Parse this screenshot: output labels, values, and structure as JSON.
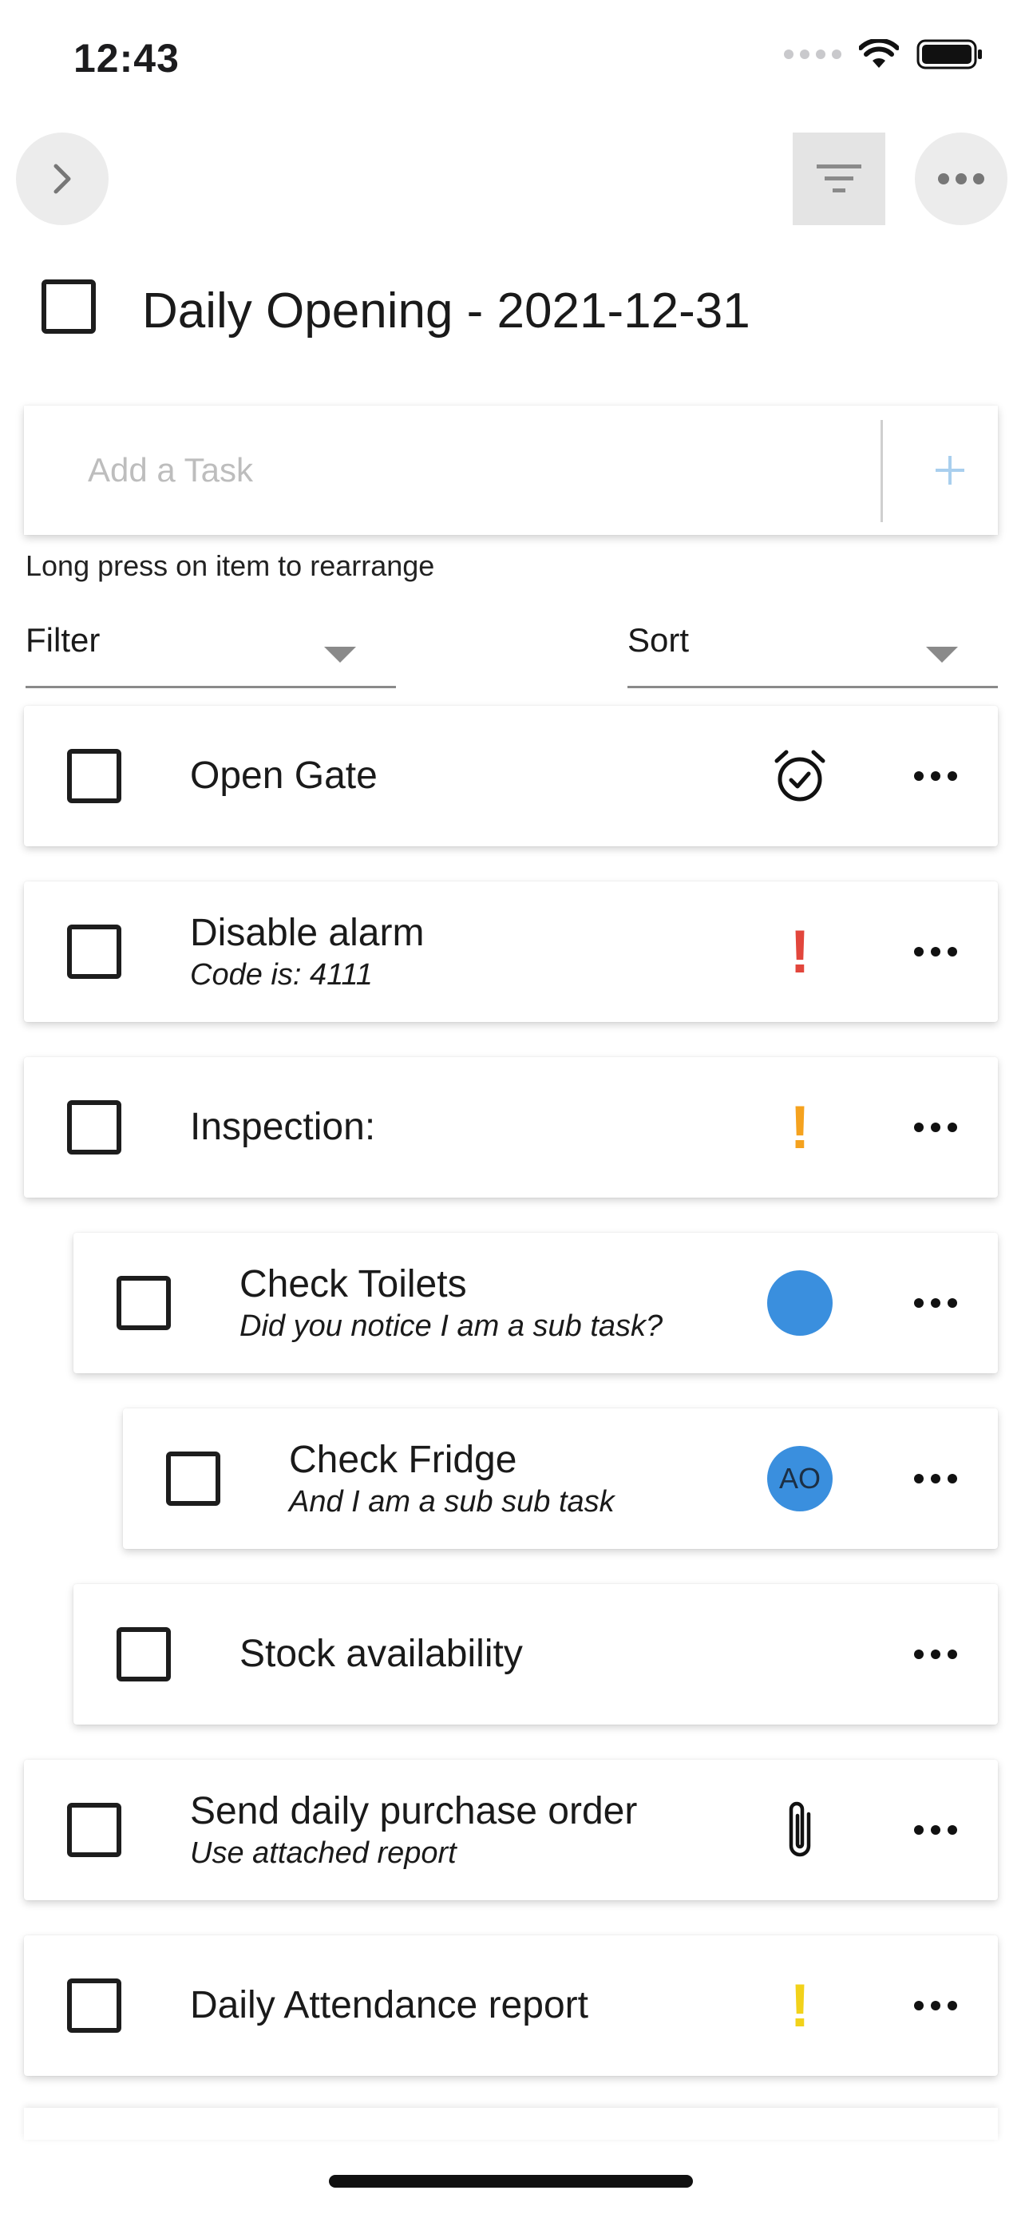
{
  "status_bar": {
    "time": "12:43"
  },
  "header": {
    "list_title": "Daily Opening - 2021-12-31"
  },
  "add_task": {
    "placeholder": "Add a Task",
    "add_symbol": "+"
  },
  "hint": "Long press on item to rearrange",
  "filter": {
    "label": "Filter"
  },
  "sort": {
    "label": "Sort"
  },
  "tasks": [
    {
      "title": "Open Gate",
      "subtitle": "",
      "badge": "alarm-clock-icon",
      "indent_level": 0
    },
    {
      "title": "Disable alarm",
      "subtitle": "Code is: 4111",
      "badge": "!",
      "badge_color": "#e2463c",
      "indent_level": 0
    },
    {
      "title": "Inspection:",
      "subtitle": "",
      "badge": "!",
      "badge_color": "#f5a21e",
      "indent_level": 0
    },
    {
      "title": "Check Toilets",
      "subtitle": "Did you notice I am a sub task?",
      "badge": "avatar",
      "badge_color": "#3a8fde",
      "indent_level": 1
    },
    {
      "title": "Check Fridge",
      "subtitle": "And I am a sub sub task",
      "badge": "avatar",
      "avatar_initials": "AO",
      "badge_color": "#3a8fde",
      "indent_level": 2
    },
    {
      "title": "Stock availability",
      "subtitle": "",
      "badge": "",
      "indent_level": 1
    },
    {
      "title": "Send daily purchase order",
      "subtitle": "Use attached report",
      "badge": "paperclip-icon",
      "indent_level": 0
    },
    {
      "title": "Daily Attendance report",
      "subtitle": "",
      "badge": "!",
      "badge_color": "#f2d21a",
      "indent_level": 0
    }
  ]
}
